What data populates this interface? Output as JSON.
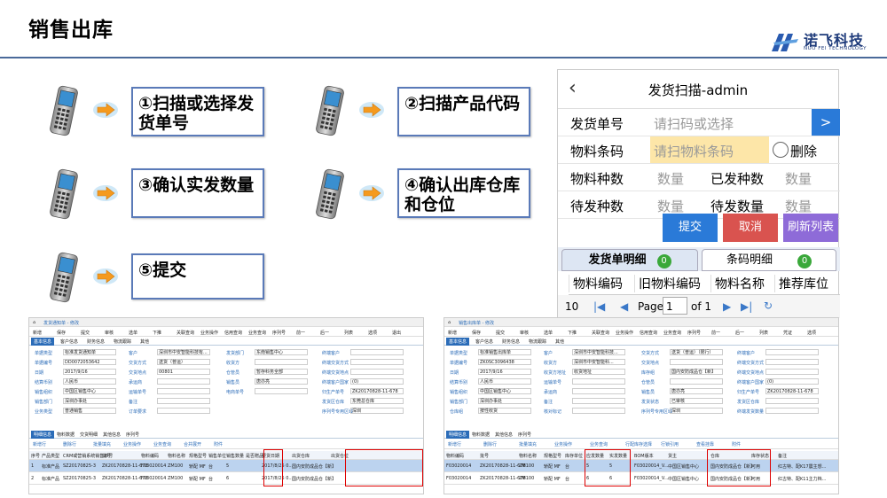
{
  "title": "销售出库",
  "logo": {
    "brand": "诺飞科技",
    "sub": "NUO FEI TECHNOLOGY"
  },
  "steps": [
    {
      "label": "①扫描或选择发货单号"
    },
    {
      "label": "②扫描产品代码"
    },
    {
      "label": "③确认实发数量"
    },
    {
      "label": "④确认出库仓库和仓位"
    },
    {
      "label": "⑤提交"
    }
  ],
  "mobile": {
    "back_icon": "chevron-left-icon",
    "header": "发货扫描-admin",
    "order_label": "发货单号",
    "order_placeholder": "请扫码或选择",
    "order_btn": ">",
    "barcode_label": "物料条码",
    "barcode_placeholder": "请扫物料条码",
    "delete_label": "删除",
    "kinds_label": "物料种数",
    "kinds_value": "数量",
    "shipped_kinds_label": "已发种数",
    "shipped_kinds_value": "数量",
    "pending_kinds_label": "待发种数",
    "pending_kinds_value": "数量",
    "pending_qty_label": "待发数量",
    "pending_qty_value": "数量",
    "submit": "提交",
    "cancel": "取消",
    "refresh": "刷新列表",
    "tab1": "发货单明细",
    "tab1_count": "0",
    "tab2": "条码明细",
    "tab2_count": "0",
    "cols": [
      "物料编码",
      "旧物料编码",
      "物料名称",
      "推荐库位"
    ],
    "pager": {
      "size": "10",
      "page_label": "Page",
      "page": "1",
      "of": "of 1"
    },
    "colors": {
      "submit": "#2a7ad8",
      "cancel": "#d9534f",
      "refresh": "#8e6bd8",
      "highlight": "#fde6a8"
    }
  },
  "left_shot": {
    "title": "发货通知单 - 修改",
    "toolbar": [
      "新增",
      "保存",
      "提交",
      "审核",
      "选单",
      "下推",
      "关联查询",
      "业务操作",
      "信用查询",
      "业务查询",
      "序列号",
      "前一",
      "后一",
      "列表",
      "选项",
      "退出"
    ],
    "tabs": [
      "基本信息",
      "客户信息",
      "财务信息",
      "物流跟踪",
      "其他"
    ],
    "fields": [
      [
        "单据类型",
        "标准发货通知单"
      ],
      [
        "单据编号",
        "DD0072053642"
      ],
      [
        "日期",
        "2017/9/16"
      ],
      [
        "结算币别",
        "人民币"
      ],
      [
        "销售组织",
        "中国区销售中心"
      ],
      [
        "销售部门",
        "深圳办事处"
      ],
      [
        "业务类型",
        "普通销售"
      ],
      [
        "客户",
        "深圳市中安智能科技有..."
      ],
      [
        "交货方式",
        "送货（普运）"
      ],
      [
        "交货地点",
        "00801"
      ],
      [
        "承运商",
        ""
      ],
      [
        "运输单号",
        ""
      ],
      [
        "备注",
        ""
      ],
      [
        "订单要求",
        ""
      ],
      [
        "发货部门",
        "东南销售中心"
      ],
      [
        "收货方",
        ""
      ],
      [
        "仓管员",
        "暂存科务全部"
      ],
      [
        "销售员",
        "唐亦亮"
      ],
      [
        "电商单号",
        ""
      ],
      [
        "终端客户",
        ""
      ],
      [
        "终端交货方式",
        ""
      ],
      [
        "终端交货地点",
        ""
      ],
      [
        "终端客户国家",
        "(0)"
      ],
      [
        "归生产单号",
        "ZK20170828-11-678"
      ],
      [
        "发货区仓库",
        "东莞总仓库"
      ],
      [
        "序列号专用区域",
        "深圳"
      ]
    ],
    "subtabs": [
      "明细信息",
      "物料数据",
      "交货明细",
      "其他信息",
      "序列号"
    ],
    "subtools": [
      "新增行",
      "删除行",
      "批量填充",
      "业务操作",
      "业务查询",
      "合并展开",
      "附件"
    ],
    "cols": [
      "序号",
      "产品类型",
      "CRM或营销系统销售单号",
      "批号",
      "物料编码",
      "物料名称",
      "规格型号",
      "销售单位",
      "销售数量",
      "是否赠品",
      "要货日期",
      "出货仓库",
      "出货仓位"
    ],
    "rows": [
      [
        "1",
        "标准产品",
        "SZ20170825-3",
        "ZK20170828-11-678",
        "F03020014",
        "ZM100",
        "轿配 MF",
        "台",
        "5",
        "",
        "2017/8/25 0...",
        "国内安防成品仓【新】",
        ""
      ],
      [
        "2",
        "标准产品",
        "SZ20170825-3",
        "ZK20170828-11-678",
        "F03020014",
        "ZM100",
        "轿配 MF",
        "台",
        "6",
        "",
        "2017/8/25 0...",
        "国内安防成品仓【新】",
        ""
      ]
    ]
  },
  "right_shot": {
    "title": "销售出库单 - 修改",
    "toolbar": [
      "新增",
      "保存",
      "提交",
      "审核",
      "选单",
      "下推",
      "关联查询",
      "业务操作",
      "信用查询",
      "业务查询",
      "序列号",
      "前一",
      "后一",
      "列表",
      "凭证",
      "选项"
    ],
    "tabs": [
      "基本信息",
      "客户信息",
      "财务信息",
      "物流跟踪",
      "其他"
    ],
    "fields": [
      [
        "单据类型",
        "标准销售出库单"
      ],
      [
        "单据编号",
        "ZK0SC3096438"
      ],
      [
        "日期",
        "2017/9/16"
      ],
      [
        "结算币别",
        "人民币"
      ],
      [
        "销售组织",
        "中国区销售中心"
      ],
      [
        "销售部门",
        "深圳办事处"
      ],
      [
        "仓库组",
        "按性收货"
      ],
      [
        "客户",
        "深圳市中安智能科技..."
      ],
      [
        "收货方",
        "深圳市中安智能科..."
      ],
      [
        "收货方地址",
        "收货地址"
      ],
      [
        "运输单号",
        ""
      ],
      [
        "承运商",
        ""
      ],
      [
        "备注",
        ""
      ],
      [
        "核对标记",
        ""
      ],
      [
        "交货方式",
        "送货（普运）（限行）"
      ],
      [
        "交货地点",
        ""
      ],
      [
        "库存组",
        "国内安防成品仓【新】"
      ],
      [
        "仓管员",
        ""
      ],
      [
        "销售员",
        "唐亦亮"
      ],
      [
        "发货状态",
        "已审核"
      ],
      [
        "序列号专用区域",
        "深圳"
      ],
      [
        "终端客户",
        ""
      ],
      [
        "终端交货方式",
        ""
      ],
      [
        "终端交货地点",
        ""
      ],
      [
        "终端客户国家",
        "(0)"
      ],
      [
        "归生产单号",
        "ZK20170828-11-678"
      ],
      [
        "发货区仓库",
        ""
      ],
      [
        "终端发货数量",
        ""
      ]
    ],
    "subtabs": [
      "明细信息",
      "物料数据",
      "其他信息",
      "序列号"
    ],
    "subtools": [
      "新增行",
      "删除行",
      "批量填充",
      "业务操作",
      "业务查询",
      "行配库存选择",
      "行锁引用",
      "查看挂靠",
      "附件"
    ],
    "cols": [
      "物料编码",
      "批号",
      "物料名称",
      "规格型号",
      "库存单位",
      "应发数量",
      "实发数量",
      "BOM版本",
      "货主",
      "仓库",
      "库存状态",
      "备注"
    ],
    "rows": [
      [
        "F03020014",
        "ZK20170828-11-678",
        "ZM100",
        "轿配 MF",
        "台",
        "5",
        "5",
        "F03020014_V...",
        "中国区销售中心",
        "国内安防成品仓【新】",
        "可用",
        "红古特、配K17震主想..."
      ],
      [
        "F03020014",
        "ZK20170828-11-678",
        "ZM100",
        "轿配 MF",
        "台",
        "6",
        "6",
        "F03020014_V...",
        "中国区销售中心",
        "国内安防成品仓【新】",
        "可用",
        "红古特、配K11主力档..."
      ]
    ]
  }
}
